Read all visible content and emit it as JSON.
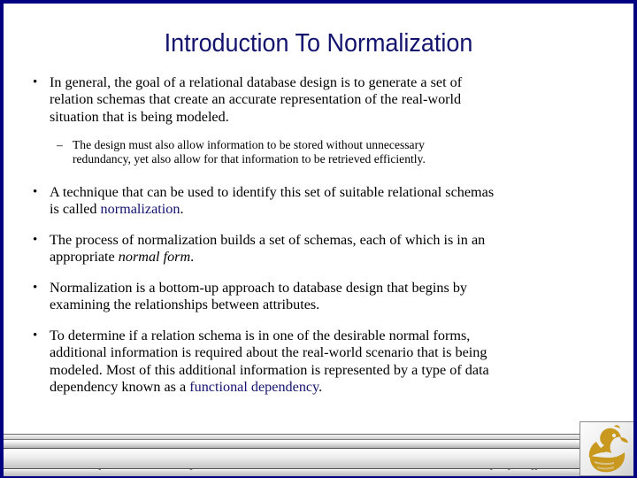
{
  "slide": {
    "title": "Introduction To Normalization",
    "accent_color": "#13136e",
    "border_color": "#000080",
    "background_color": "#ffffff",
    "bullets": [
      {
        "marker": "•",
        "level": 1,
        "line1": "In general, the goal of a relational database design is to generate a set of",
        "line2": "relation schemas that create an accurate representation of the real-world",
        "line3": "situation that is being modeled."
      },
      {
        "marker": "–",
        "level": 2,
        "line1": "The design must also allow information to be stored without unnecessary",
        "line2": "redundancy, yet also allow for that information to be retrieved efficiently."
      },
      {
        "marker": "•",
        "level": 1,
        "line1": "A technique that can be used to identify this set of suitable relational schemas",
        "line2_pre": "is called ",
        "line2_highlight": "normalization",
        "line2_post": "."
      },
      {
        "marker": "•",
        "level": 1,
        "line1": "The process of normalization builds a set of schemas, each of which is in an",
        "line2_pre": "appropriate ",
        "line2_italic": "normal form",
        "line2_post": "."
      },
      {
        "marker": "•",
        "level": 1,
        "line1": "Normalization is a bottom-up approach to database design that begins by",
        "line2": "examining the relationships between attributes."
      },
      {
        "marker": "•",
        "level": 1,
        "line1": "To determine if a relation schema is in one of the desirable normal forms,",
        "line2": "additional information is required about the real-world scenario that is being",
        "line3": "modeled.  Most of this additional information is represented by a type of data",
        "line4_pre": "dependency known as a ",
        "line4_highlight": "functional dependency",
        "line4_post": "."
      }
    ]
  },
  "footer": {
    "course": "CGS 2545: Database Concepts  (Chapter 5)",
    "page": "Page 2",
    "author": "Mark Llewellyn",
    "logo_name": "ucf-pegasus-logo",
    "logo_color": "#c8981f"
  }
}
